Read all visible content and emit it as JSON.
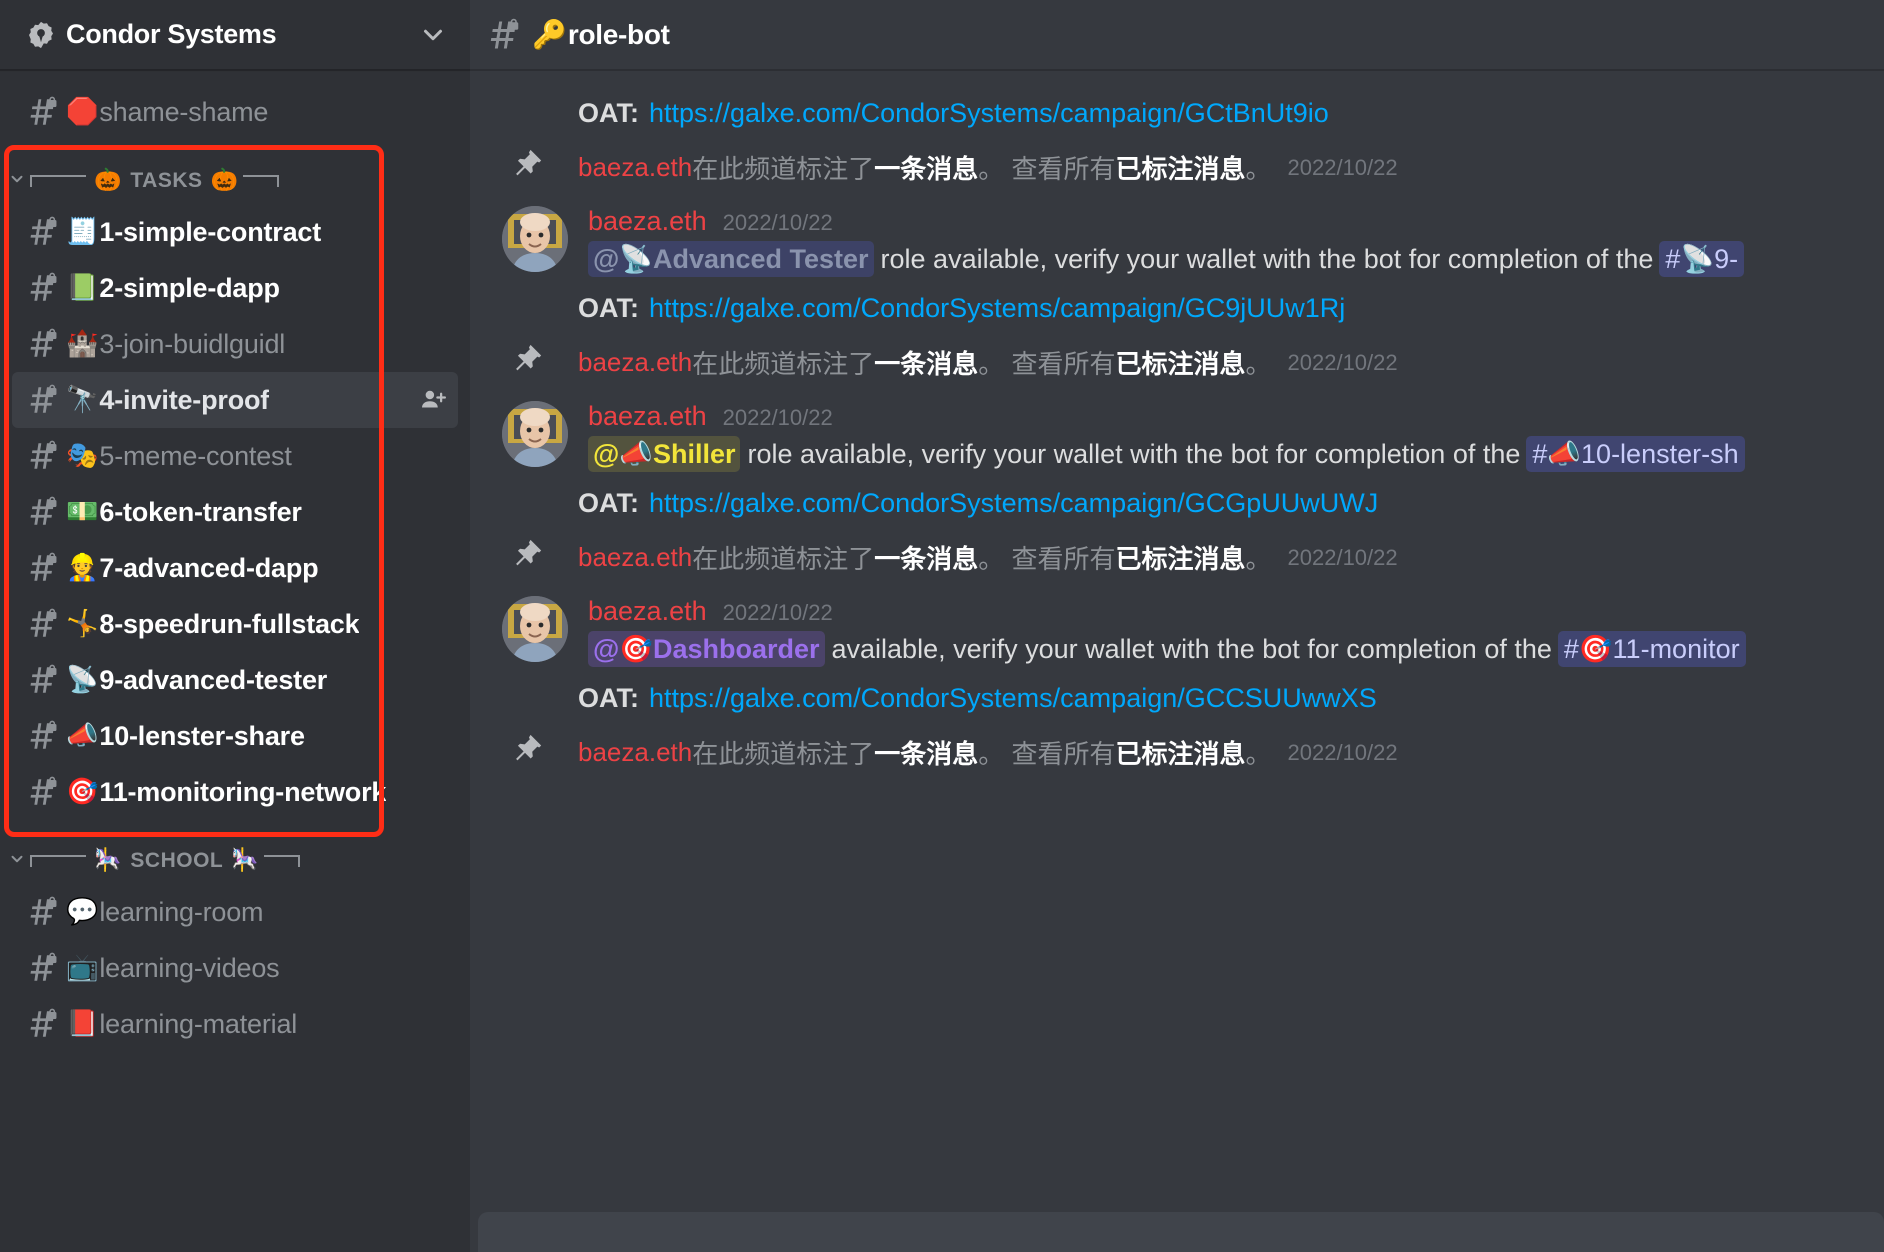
{
  "server": {
    "name": "Condor Systems",
    "badge_icon": "verified-server-badge",
    "dropdown_icon": "chevron-down-icon"
  },
  "sidebar": {
    "top_channels": [
      {
        "emoji": "🛑",
        "label": "shame-shame",
        "state": "read",
        "icon": "hash-locked-icon"
      }
    ],
    "categories": [
      {
        "name": "TASKS",
        "emoji_left": "🎃",
        "emoji_right": "🎃",
        "caret_icon": "chevron-down-icon",
        "highlighted": true,
        "channels": [
          {
            "emoji": "🧾",
            "label": "1-simple-contract",
            "state": "unread"
          },
          {
            "emoji": "📗",
            "label": "2-simple-dapp",
            "state": "unread"
          },
          {
            "emoji": "🏰",
            "label": "3-join-buidlguidl",
            "state": "read"
          },
          {
            "emoji": "🔭",
            "label": "4-invite-proof",
            "state": "active"
          },
          {
            "emoji": "🎭",
            "label": "5-meme-contest",
            "state": "read"
          },
          {
            "emoji": "💵",
            "label": "6-token-transfer",
            "state": "unread"
          },
          {
            "emoji": "👷",
            "label": "7-advanced-dapp",
            "state": "unread"
          },
          {
            "emoji": "🤸",
            "label": "8-speedrun-fullstack",
            "state": "unread"
          },
          {
            "emoji": "📡",
            "label": "9-advanced-tester",
            "state": "unread"
          },
          {
            "emoji": "📣",
            "label": "10-lenster-share",
            "state": "unread"
          },
          {
            "emoji": "🎯",
            "label": "11-monitoring-network",
            "state": "unread"
          }
        ]
      },
      {
        "name": "SCHOOL",
        "emoji_left": "🎠",
        "emoji_right": "🎠",
        "caret_icon": "chevron-down-icon",
        "highlighted": false,
        "channels": [
          {
            "emoji": "💬",
            "label": "learning-room",
            "state": "read"
          },
          {
            "emoji": "📺",
            "label": "learning-videos",
            "state": "read"
          },
          {
            "emoji": "📕",
            "label": "learning-material",
            "state": "read"
          }
        ]
      }
    ],
    "active_channel_action_icon": "add-member-icon"
  },
  "channel_header": {
    "emoji": "🔑",
    "title": "role-bot",
    "hash_icon": "hash-locked-icon"
  },
  "messages": [
    {
      "type": "oat",
      "label": "OAT:",
      "url": "https://galxe.com/CondorSystems/campaign/GCtBnUt9io"
    },
    {
      "type": "pin",
      "icon": "pin-icon",
      "user": "baeza.eth",
      "text_1": "在此频道标注了",
      "bold_1": "一条消息",
      "text_2": "。 查看所有",
      "bold_2": "已标注消息",
      "text_3": "。",
      "date": "2022/10/22"
    },
    {
      "type": "message",
      "author": "baeza.eth",
      "date": "2022/10/22",
      "avatar": "user-avatar",
      "mention": {
        "at": "@",
        "emoji": "📡",
        "name": "Advanced Tester",
        "style": "tester"
      },
      "body": "role available, verify your wallet with the bot for completion of the",
      "channel_chip": {
        "hash": "#",
        "emoji": "📡",
        "name": "9-"
      }
    },
    {
      "type": "oat",
      "label": "OAT:",
      "url": "https://galxe.com/CondorSystems/campaign/GC9jUUw1Rj"
    },
    {
      "type": "pin",
      "icon": "pin-icon",
      "user": "baeza.eth",
      "text_1": "在此频道标注了",
      "bold_1": "一条消息",
      "text_2": "。 查看所有",
      "bold_2": "已标注消息",
      "text_3": "。",
      "date": "2022/10/22"
    },
    {
      "type": "message",
      "author": "baeza.eth",
      "date": "2022/10/22",
      "avatar": "user-avatar",
      "mention": {
        "at": "@",
        "emoji": "📣",
        "name": "Shiller",
        "style": "shiller"
      },
      "body": "role available, verify your wallet with the bot for completion of the",
      "channel_chip": {
        "hash": "#",
        "emoji": "📣",
        "name": "10-lenster-sh"
      }
    },
    {
      "type": "oat",
      "label": "OAT:",
      "url": "https://galxe.com/CondorSystems/campaign/GCGpUUwUWJ"
    },
    {
      "type": "pin",
      "icon": "pin-icon",
      "user": "baeza.eth",
      "text_1": "在此频道标注了",
      "bold_1": "一条消息",
      "text_2": "。 查看所有",
      "bold_2": "已标注消息",
      "text_3": "。",
      "date": "2022/10/22"
    },
    {
      "type": "message",
      "author": "baeza.eth",
      "date": "2022/10/22",
      "avatar": "user-avatar",
      "mention": {
        "at": "@",
        "emoji": "🎯",
        "name": "Dashboarder",
        "style": "dash"
      },
      "body": "available, verify your wallet with the bot for completion of the",
      "channel_chip": {
        "hash": "#",
        "emoji": "🎯",
        "name": "11-monitor"
      }
    },
    {
      "type": "oat",
      "label": "OAT:",
      "url": "https://galxe.com/CondorSystems/campaign/GCCSUUwwXS"
    },
    {
      "type": "pin",
      "icon": "pin-icon",
      "user": "baeza.eth",
      "text_1": "在此频道标注了",
      "bold_1": "一条消息",
      "text_2": "。 查看所有",
      "bold_2": "已标注消息",
      "text_3": "。",
      "date": "2022/10/22"
    }
  ],
  "colors": {
    "sidebar_bg": "#2f3136",
    "main_bg": "#36393f",
    "highlight_box": "#ff2d16",
    "link": "#00a8fc",
    "username": "#ed4245",
    "muted_text": "#8e9297"
  }
}
